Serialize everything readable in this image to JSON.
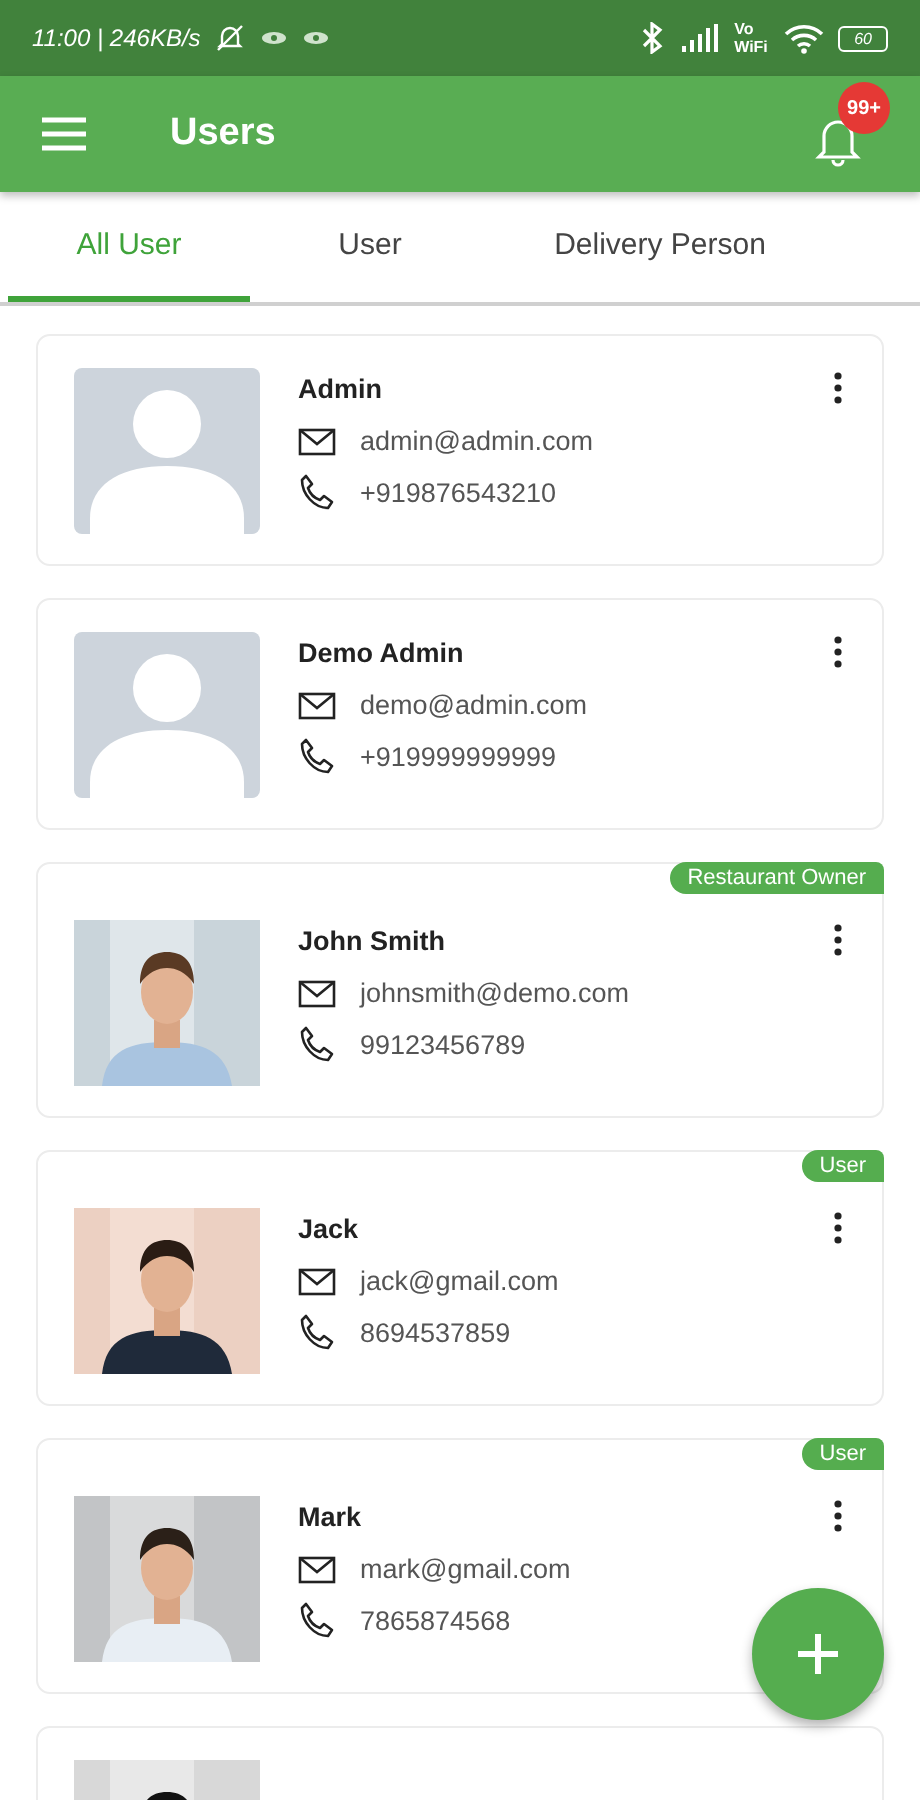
{
  "status_bar": {
    "time": "11:00 | 246KB/s",
    "vowifi": "Vo WiFi",
    "battery": "60"
  },
  "app_bar": {
    "title": "Users",
    "notification_badge": "99+"
  },
  "tabs": [
    {
      "label": "All User",
      "selected": true
    },
    {
      "label": "User",
      "selected": false
    },
    {
      "label": "Delivery Person",
      "selected": false
    }
  ],
  "users": [
    {
      "name": "Admin",
      "email": "admin@admin.com",
      "phone": "+919876543210",
      "kind": "placeholder"
    },
    {
      "name": "Demo Admin",
      "email": "demo@admin.com",
      "phone": "+919999999999",
      "kind": "placeholder"
    },
    {
      "name": "John Smith",
      "email": "johnsmith@demo.com",
      "phone": "99123456789",
      "kind": "picture",
      "role": "Restaurant Owner"
    },
    {
      "name": "Jack",
      "email": "jack@gmail.com",
      "phone": "8694537859",
      "kind": "picture",
      "role": "User"
    },
    {
      "name": "Mark",
      "email": "mark@gmail.com",
      "phone": "7865874568",
      "kind": "picture",
      "role": "User"
    },
    {
      "kind": "picture"
    }
  ]
}
